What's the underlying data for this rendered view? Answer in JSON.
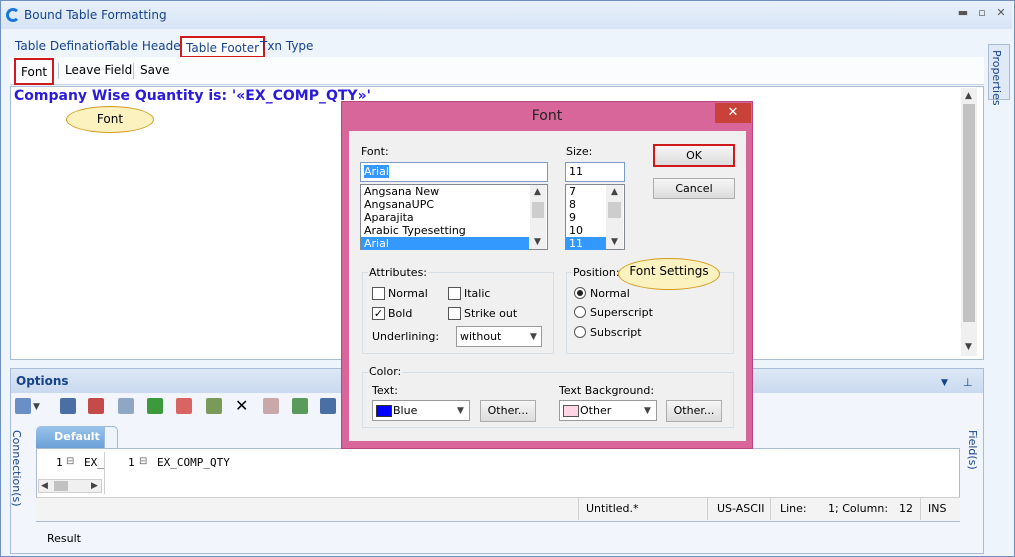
{
  "window": {
    "title": "Bound Table Formatting"
  },
  "tabs": [
    {
      "label": "Table Defination"
    },
    {
      "label": "Table Header"
    },
    {
      "label": "Table Footer"
    },
    {
      "label": "Txn Type"
    }
  ],
  "toolbar": {
    "font_label": "Font",
    "leave_field_label": "Leave Field",
    "save_label": "Save"
  },
  "editor": {
    "text": "Company Wise Quantity is: '«EX_COMP_QTY»'"
  },
  "callouts": {
    "font": "Font",
    "font_settings": "Font Settings"
  },
  "side": {
    "properties": "Properties"
  },
  "options": {
    "title": "Options",
    "connections_label": "Connection(s)",
    "fields_label": "Field(s)",
    "default_tab": "Default",
    "tree_left": {
      "line": "1",
      "text": "EX_"
    },
    "tree_right": {
      "line": "1",
      "text": "EX_COMP_QTY"
    },
    "status": {
      "file": "Untitled.*",
      "encoding": "US-ASCII",
      "line_label": "Line:",
      "line_value": "1; Column:",
      "column_value": "12",
      "mode": "INS"
    },
    "result_label": "Result"
  },
  "font_dialog": {
    "title": "Font",
    "font_label": "Font:",
    "font_value": "Arial",
    "font_list": [
      "Angsana New",
      "AngsanaUPC",
      "Aparajita",
      "Arabic Typesetting",
      "Arial"
    ],
    "size_label": "Size:",
    "size_value": "11",
    "size_list": [
      "7",
      "8",
      "9",
      "10",
      "11"
    ],
    "ok_label": "OK",
    "cancel_label": "Cancel",
    "attributes_label": "Attributes:",
    "normal_label": "Normal",
    "italic_label": "Italic",
    "bold_label": "Bold",
    "strikeout_label": "Strike out",
    "underlining_label": "Underlining:",
    "underlining_value": "without",
    "position_label": "Position:",
    "pos_normal": "Normal",
    "pos_superscript": "Superscript",
    "pos_subscript": "Subscript",
    "color_label": "Color:",
    "text_label": "Text:",
    "text_color": "Blue",
    "text_bg_label": "Text Background:",
    "bg_color": "Other",
    "other_button": "Other...",
    "colors": {
      "text": "#0000ff",
      "background": "#ffd6e6"
    }
  }
}
